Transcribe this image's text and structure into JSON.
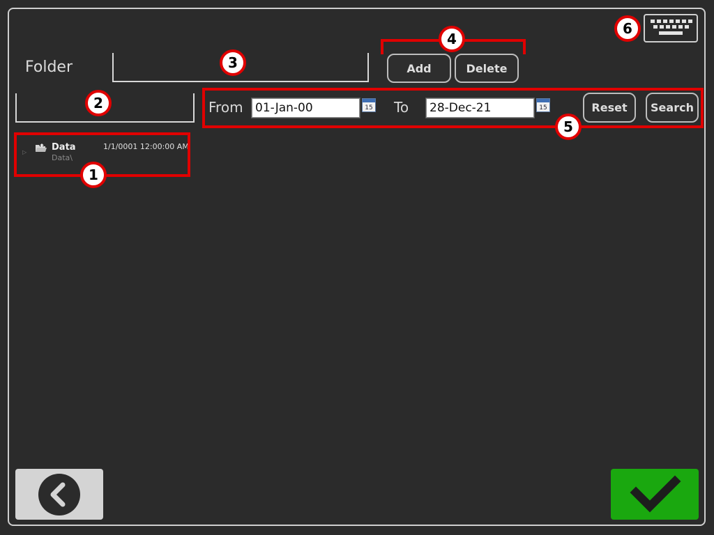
{
  "folder": {
    "label": "Folder",
    "name_value": "",
    "filter_value": ""
  },
  "buttons": {
    "add": "Add",
    "delete": "Delete",
    "reset": "Reset",
    "search": "Search"
  },
  "date_range": {
    "from_label": "From",
    "from_value": "01-Jan-00",
    "to_label": "To",
    "to_value": "28-Dec-21",
    "calendar_day": "15"
  },
  "tree": {
    "items": [
      {
        "title": "Data",
        "path": "Data\\",
        "timestamp": "1/1/0001 12:00:00 AM",
        "icon": "folder-open-icon"
      }
    ]
  },
  "annotations": {
    "m1": "1",
    "m2": "2",
    "m3": "3",
    "m4": "4",
    "m5": "5",
    "m6": "6"
  },
  "colors": {
    "background": "#2b2b2b",
    "annotation_red": "#e00000",
    "confirm_green": "#1aa80f",
    "back_button": "#d4d4d4"
  }
}
